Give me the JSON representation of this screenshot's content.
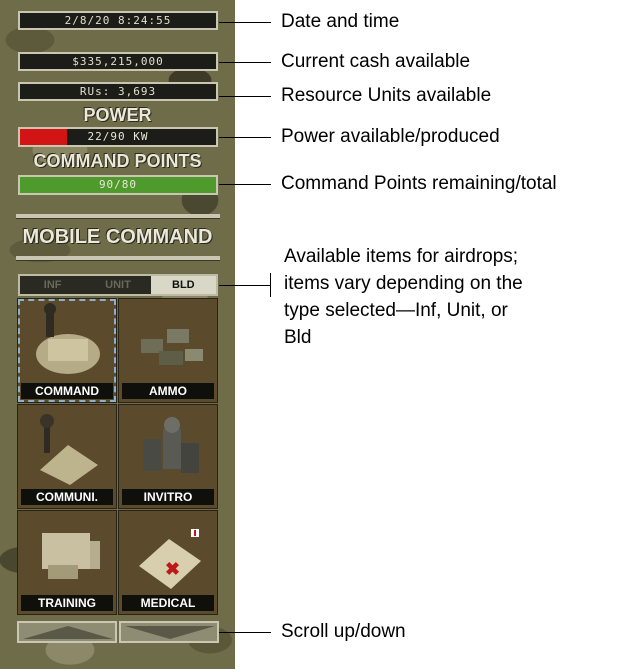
{
  "hud": {
    "date_time": "2/8/20 8:24:55",
    "cash": "$335,215,000",
    "resources": "RUs: 3,693",
    "power_heading": "POWER",
    "power_value": "22/90 KW",
    "power_fill": 0.24,
    "command_points_heading": "COMMAND POINTS",
    "command_points_value": "90/80",
    "command_points_fill": 1.0,
    "mobile_command_title": "MOBILE COMMAND"
  },
  "tabs": [
    {
      "label": "INF",
      "active": false
    },
    {
      "label": "UNIT",
      "active": false
    },
    {
      "label": "BLD",
      "active": true
    }
  ],
  "items": [
    {
      "label": "COMMAND",
      "selected": true
    },
    {
      "label": "AMMO",
      "selected": false
    },
    {
      "label": "COMMUNI.",
      "selected": false
    },
    {
      "label": "INVITRO",
      "selected": false
    },
    {
      "label": "TRAINING",
      "selected": false
    },
    {
      "label": "MEDICAL",
      "selected": false
    }
  ],
  "callouts": {
    "date_time": "Date and time",
    "cash": "Current cash available",
    "resources": "Resource Units available",
    "power": "Power available/produced",
    "command_points": "Command Points remaining/total",
    "airdrops_line1": "Available items for airdrops;",
    "airdrops_line2": "items vary depending on the",
    "airdrops_line3": "type selected—Inf, Unit, or",
    "airdrops_line4": "Bld",
    "scroll": "Scroll up/down"
  },
  "colors": {
    "power_fill": "#d31414",
    "command_points_fill": "#4f9a2c"
  }
}
